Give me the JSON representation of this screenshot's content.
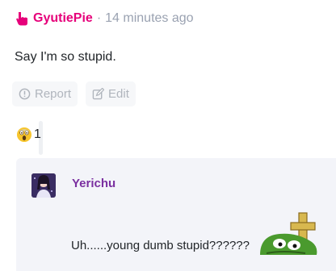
{
  "comment": {
    "author": "GyutiePie",
    "separator": "·",
    "time": "14 minutes ago",
    "text": "Say I'm so stupid.",
    "author_color": "#e6007a"
  },
  "actions": {
    "report_label": "Report",
    "edit_label": "Edit"
  },
  "reactions": [
    {
      "emoji": "screaming-face-icon",
      "count": "1"
    }
  ],
  "reply": {
    "author": "Yerichu",
    "text": "Uh......young dumb stupid??????",
    "author_color": "#7a2fa0"
  }
}
